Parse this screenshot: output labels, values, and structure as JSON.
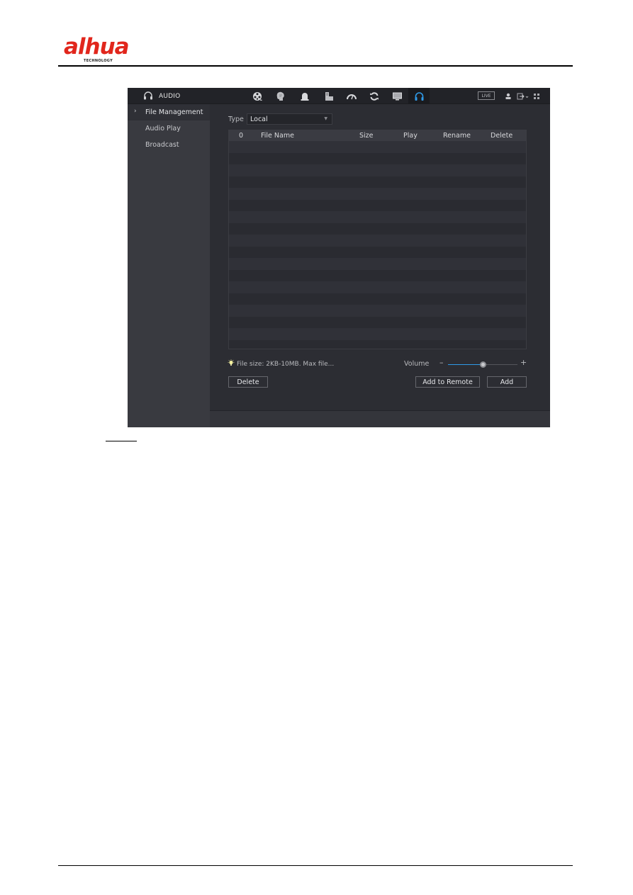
{
  "document": {
    "brand": "alhua",
    "brand_tagline": "TECHNOLOGY"
  },
  "app": {
    "title": "AUDIO",
    "title_icon": "headphones-icon",
    "nav_icons": [
      {
        "name": "playback-icon",
        "active": false
      },
      {
        "name": "ai-face-icon",
        "active": false
      },
      {
        "name": "alarm-bell-icon",
        "active": false
      },
      {
        "name": "backup-storage-icon",
        "active": false
      },
      {
        "name": "operation-gauge-icon",
        "active": false
      },
      {
        "name": "maintenance-refresh-icon",
        "active": false
      },
      {
        "name": "display-monitor-icon",
        "active": false
      },
      {
        "name": "audio-headphones-icon",
        "active": true
      }
    ],
    "live_label": "LIVE",
    "accent_color": "#2f9be8"
  },
  "sidebar": {
    "items": [
      {
        "label": "File Management",
        "selected": true
      },
      {
        "label": "Audio Play",
        "selected": false
      },
      {
        "label": "Broadcast",
        "selected": false
      }
    ]
  },
  "filters": {
    "type_label": "Type",
    "type_value": "Local"
  },
  "table": {
    "columns": [
      "0",
      "File Name",
      "Size",
      "Play",
      "Rename",
      "Delete"
    ],
    "rows": []
  },
  "footer": {
    "hint": "File size: 2KB-10MB. Max file...",
    "volume_label": "Volume",
    "volume_value": 0.5,
    "delete_label": "Delete",
    "add_remote_label": "Add to Remote",
    "add_label": "Add"
  }
}
